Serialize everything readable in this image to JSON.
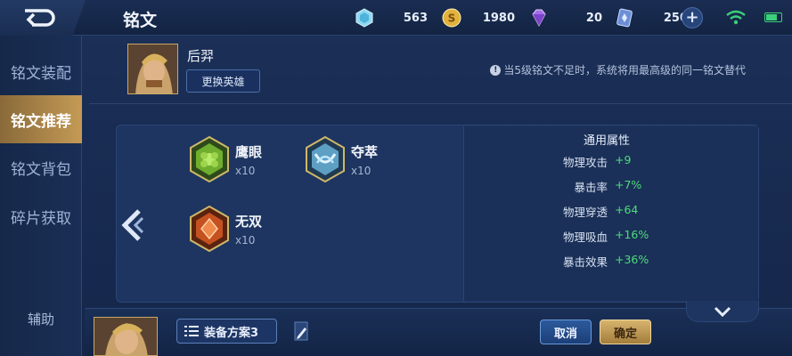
{
  "topbar": {
    "title": "铭文",
    "currencies": [
      {
        "icon": "diamond-icon",
        "value": "563"
      },
      {
        "icon": "gold-coin-icon",
        "value": "1980"
      },
      {
        "icon": "gem-icon",
        "value": "20"
      },
      {
        "icon": "voucher-icon",
        "value": "250"
      }
    ]
  },
  "nav": {
    "items": [
      {
        "label": "铭文装配"
      },
      {
        "label": "铭文推荐"
      },
      {
        "label": "铭文背包"
      },
      {
        "label": "碎片获取"
      }
    ],
    "help": "辅助"
  },
  "hero": {
    "name": "后羿",
    "change_label": "更换英雄"
  },
  "hint": "当5级铭文不足时，系统将用最高级的同一铭文替代",
  "runes": [
    {
      "name": "鹰眼",
      "count": "x10",
      "color": "#7dbf3a"
    },
    {
      "name": "夺萃",
      "count": "x10",
      "color": "#9fd0e8"
    },
    {
      "name": "无双",
      "count": "x10",
      "color": "#d6652c"
    }
  ],
  "attributes": {
    "title": "通用属性",
    "rows": [
      {
        "key": "物理攻击",
        "value": "+9"
      },
      {
        "key": "暴击率",
        "value": "+7%"
      },
      {
        "key": "物理穿透",
        "value": "+64"
      },
      {
        "key": "物理吸血",
        "value": "+16%"
      },
      {
        "key": "暴击效果",
        "value": "+36%"
      }
    ]
  },
  "bottom": {
    "plan_label": "装备方案3",
    "cancel_label": "取消",
    "confirm_label": "确定"
  }
}
